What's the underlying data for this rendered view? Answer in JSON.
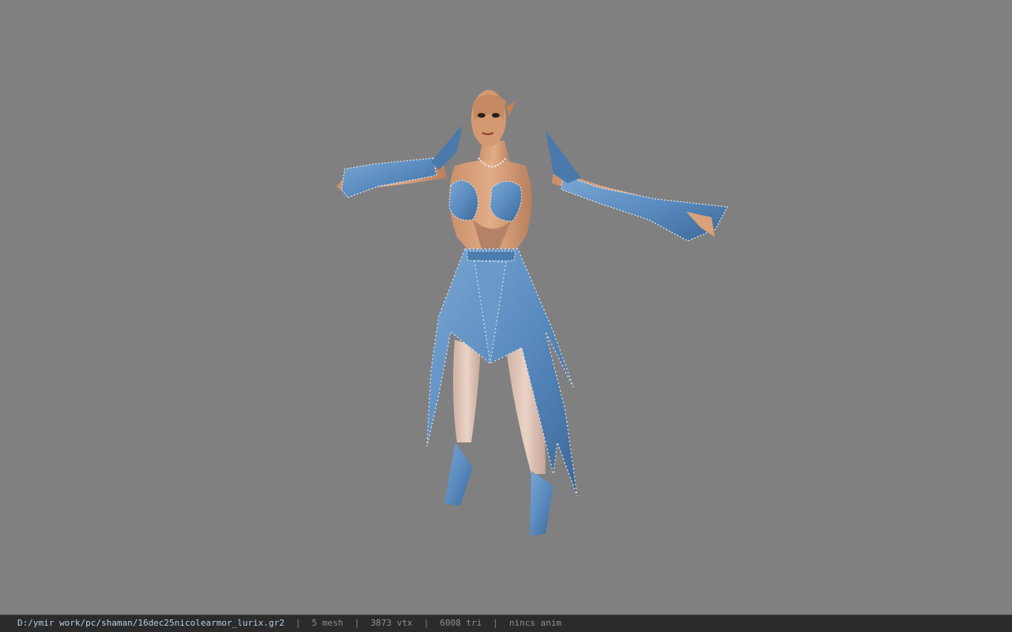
{
  "viewer": {
    "background_color": "#808080",
    "model": {
      "description_icon": "3d-character-model"
    }
  },
  "statusbar": {
    "file_path": "D:/ymir work/pc/shaman/16dec25nicolearmor_lurix.gr2",
    "separator": "|",
    "mesh": "5 mesh",
    "vtx": "3873 vtx",
    "tri": "6008 tri",
    "anim": "nincs anim"
  },
  "colors": {
    "armor_blue": "#5b8cc0",
    "armor_dark": "#3f6e9e",
    "skin": "#d9a27a",
    "skin_dark": "#b97f5e",
    "legs": "#e2c7b8",
    "statusbar_bg": "#2b2b2b"
  }
}
